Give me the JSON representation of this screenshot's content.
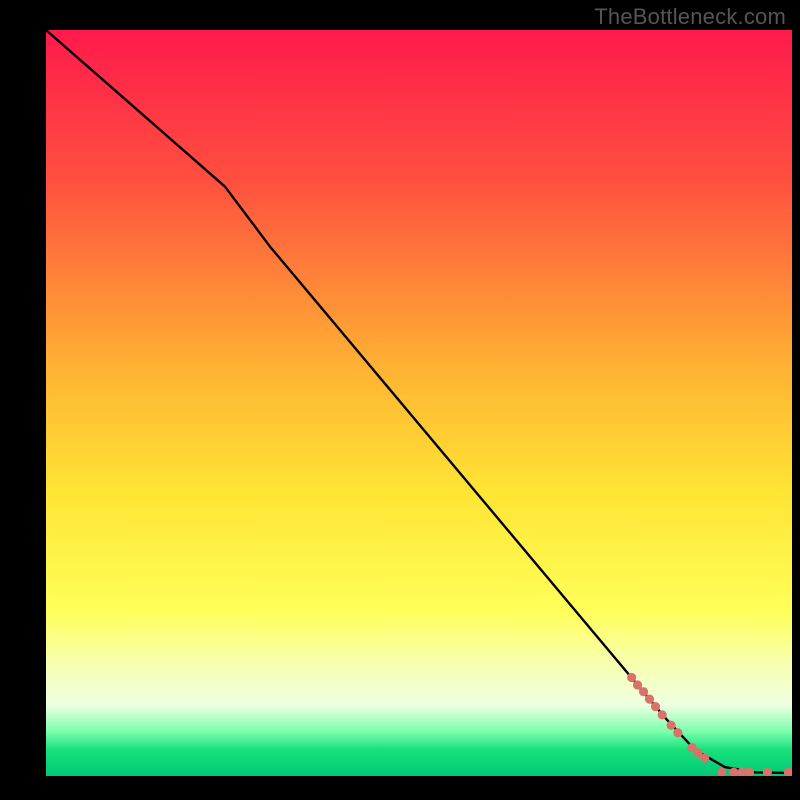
{
  "watermark": "TheBottleneck.com",
  "chart_data": {
    "type": "line",
    "title": "",
    "xlabel": "",
    "ylabel": "",
    "xlim": [
      0,
      100
    ],
    "ylim": [
      0,
      100
    ],
    "grid": false,
    "legend": false,
    "gradient_stops": [
      {
        "offset": 0.0,
        "color": "#ff1a4b"
      },
      {
        "offset": 0.2,
        "color": "#ff4f3f"
      },
      {
        "offset": 0.45,
        "color": "#ffb133"
      },
      {
        "offset": 0.62,
        "color": "#ffe534"
      },
      {
        "offset": 0.78,
        "color": "#ffff5a"
      },
      {
        "offset": 0.85,
        "color": "#f7ffb0"
      },
      {
        "offset": 0.905,
        "color": "#eeffe0"
      },
      {
        "offset": 0.94,
        "color": "#7cffad"
      },
      {
        "offset": 0.965,
        "color": "#18e07a"
      },
      {
        "offset": 1.0,
        "color": "#00c878"
      }
    ],
    "black_curve": [
      {
        "x": 0.0,
        "y": 100.0
      },
      {
        "x": 24.0,
        "y": 79.0
      },
      {
        "x": 30.0,
        "y": 71.0
      },
      {
        "x": 83.0,
        "y": 7.8
      },
      {
        "x": 87.0,
        "y": 3.5
      },
      {
        "x": 91.0,
        "y": 1.2
      },
      {
        "x": 95.0,
        "y": 0.5
      },
      {
        "x": 100.0,
        "y": 0.4
      }
    ],
    "scatter_points": [
      {
        "x": 78.5,
        "y": 13.2,
        "r": 4.6
      },
      {
        "x": 79.3,
        "y": 12.2,
        "r": 4.6
      },
      {
        "x": 80.1,
        "y": 11.3,
        "r": 4.6
      },
      {
        "x": 80.9,
        "y": 10.3,
        "r": 4.6
      },
      {
        "x": 81.7,
        "y": 9.3,
        "r": 4.6
      },
      {
        "x": 82.6,
        "y": 8.2,
        "r": 4.6
      },
      {
        "x": 83.8,
        "y": 6.8,
        "r": 4.6
      },
      {
        "x": 84.7,
        "y": 5.8,
        "r": 4.6
      },
      {
        "x": 86.6,
        "y": 3.8,
        "r": 4.6
      },
      {
        "x": 87.4,
        "y": 3.1,
        "r": 4.6
      },
      {
        "x": 88.3,
        "y": 2.4,
        "r": 4.6
      },
      {
        "x": 90.6,
        "y": 0.5,
        "r": 4.6
      },
      {
        "x": 92.2,
        "y": 0.5,
        "r": 4.6
      },
      {
        "x": 93.3,
        "y": 0.5,
        "r": 4.6
      },
      {
        "x": 94.3,
        "y": 0.5,
        "r": 4.6
      },
      {
        "x": 96.7,
        "y": 0.5,
        "r": 4.6
      },
      {
        "x": 99.5,
        "y": 0.5,
        "r": 4.6
      }
    ],
    "scatter_color": "#d9726b"
  }
}
